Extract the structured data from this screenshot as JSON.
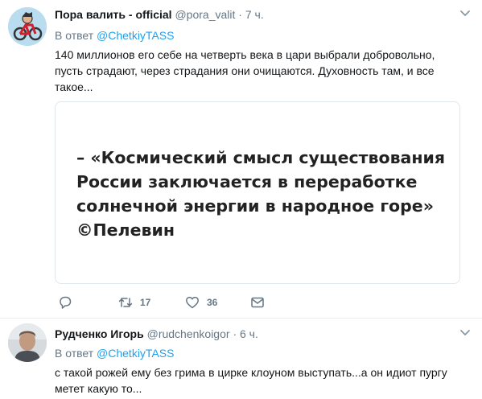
{
  "tweets": [
    {
      "name": "Пора валить - official",
      "handle": "@pora_valit",
      "dot": "·",
      "time": "7 ч.",
      "reply_prefix": "В ответ",
      "reply_mention": "@ChetkiyTASS",
      "text_lines": [
        "140 миллионов его себе на четверть века в цари выбрали добровольно,",
        "пусть страдают, через страдания они очищаются. Духовность там, и все",
        "такое..."
      ],
      "media_quote_lines": [
        "– «Космический смысл существования",
        "России заключается в переработке",
        "солнечной энергии в народное горе»",
        "©Пелевин"
      ],
      "retweet_count": "17",
      "like_count": "36"
    },
    {
      "name": "Рудченко Игорь",
      "handle": "@rudchenkoigor",
      "dot": "·",
      "time": "6 ч.",
      "reply_prefix": "В ответ",
      "reply_mention": "@ChetkiyTASS",
      "text_lines": [
        "с такой рожей ему без грима в цирке клоуном выступать...а он идиот пургу",
        "метет какую то..."
      ]
    }
  ]
}
